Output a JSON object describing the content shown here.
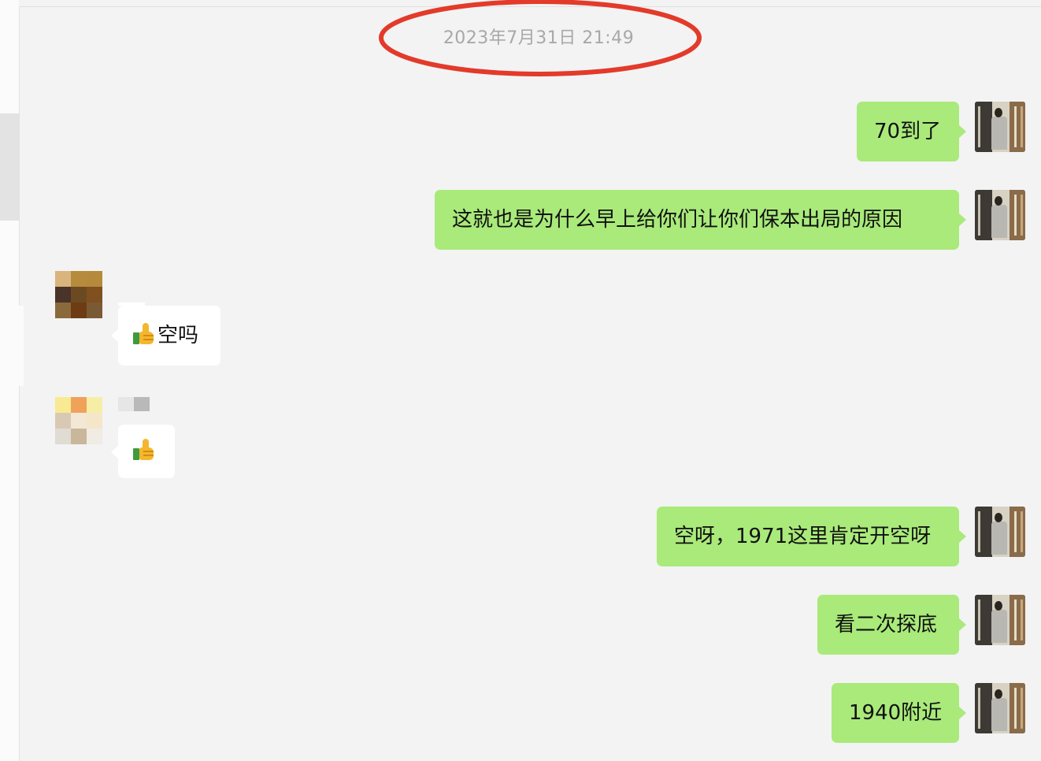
{
  "chat": {
    "timestamp": "2023年7月31日 21:49",
    "messages": [
      {
        "side": "out",
        "text": "70到了"
      },
      {
        "side": "out",
        "text": "这就也是为什么早上给你们让你们保本出局的原因"
      },
      {
        "side": "in",
        "emoji": "thumbs-up",
        "text": "空吗"
      },
      {
        "side": "in",
        "emoji": "thumbs-up",
        "text": ""
      },
      {
        "side": "out",
        "text": "空呀，1971这里肯定开空呀"
      },
      {
        "side": "out",
        "text": "看二次探底"
      },
      {
        "side": "out",
        "text": "1940附近"
      }
    ]
  },
  "colors": {
    "outgoing_bubble": "#a9ea7a",
    "incoming_bubble": "#ffffff",
    "background": "#f3f3f3",
    "timestamp_text": "#a8a8a8",
    "annotation_ellipse": "#e33a2a"
  },
  "icons": {
    "emoji": "thumbs-up-icon",
    "annotation": "red-ellipse"
  }
}
